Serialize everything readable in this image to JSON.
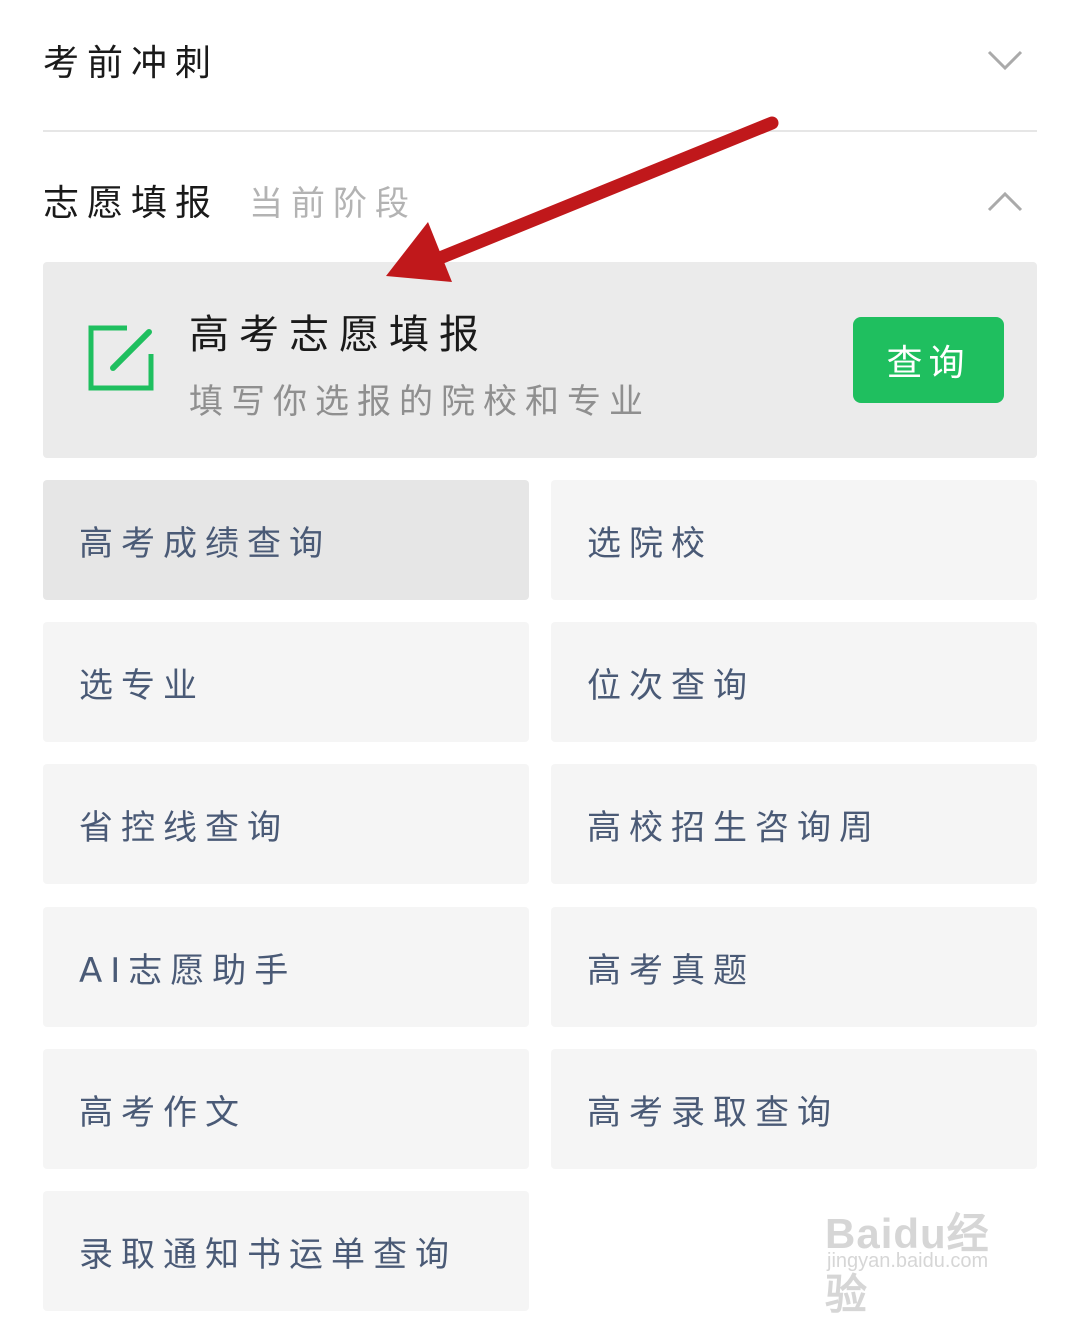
{
  "sections": {
    "sprint": {
      "title": "考前冲刺",
      "expanded": false
    },
    "volunteer": {
      "title": "志愿填报",
      "subtitle": "当前阶段",
      "expanded": true
    }
  },
  "feature_card": {
    "icon": "edit-icon",
    "title": "高考志愿填报",
    "description": "填写你选报的院校和专业",
    "button_label": "查询",
    "accent_color": "#1fbf5f"
  },
  "grid": {
    "items": [
      "高考成绩查询",
      "选院校",
      "选专业",
      "位次查询",
      "省控线查询",
      "高校招生咨询周",
      "AI志愿助手",
      "高考真题",
      "高考作文",
      "高考录取查询",
      "录取通知书运单查询"
    ]
  },
  "annotation": {
    "arrow_color": "#c0181b"
  },
  "watermark": {
    "logo": "Baidu经验",
    "url": "jingyan.baidu.com"
  }
}
